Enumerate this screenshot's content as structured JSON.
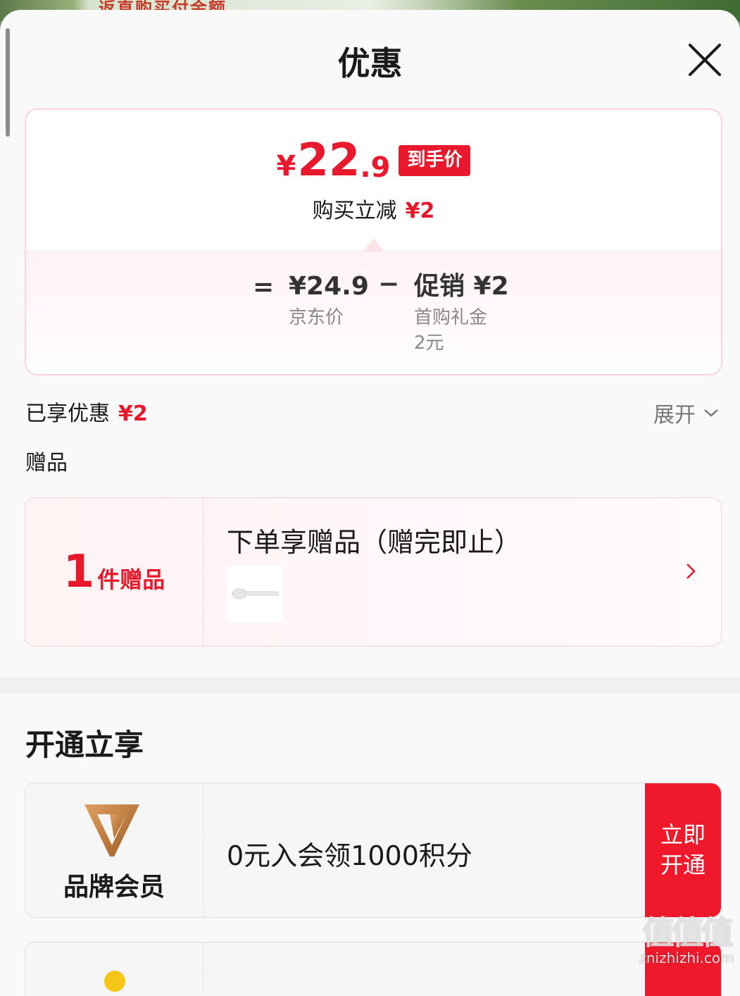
{
  "background": {
    "banner_text": "返直购买付金额"
  },
  "header": {
    "title": "优惠"
  },
  "price_card": {
    "currency": "¥",
    "price_integer": "22",
    "price_decimal": ".9",
    "badge": "到手价",
    "reduce_label": "购买立减",
    "reduce_amount": "¥2",
    "equals": "=",
    "minus": "−",
    "jd_price_value": "¥24.9",
    "jd_price_label": "京东价",
    "promo_value": "促销 ¥2",
    "promo_label_line1": "首购礼金",
    "promo_label_line2": "2元"
  },
  "enjoyed": {
    "label": "已享优惠",
    "amount": "¥2",
    "expand_label": "展开"
  },
  "gift": {
    "section_title": "赠品",
    "count": "1",
    "count_label": "件赠品",
    "description": "下单享赠品（赠完即止）"
  },
  "open_section": {
    "title": "开通立享",
    "member_name": "品牌会员",
    "member_desc": "0元入会领1000积分",
    "button_line1": "立即",
    "button_line2": "开通"
  },
  "watermark": {
    "logo": "值值值",
    "site": "znizhizhi.com"
  },
  "colors": {
    "accent": "#e8192c",
    "brand_gold": "#c8803a"
  }
}
